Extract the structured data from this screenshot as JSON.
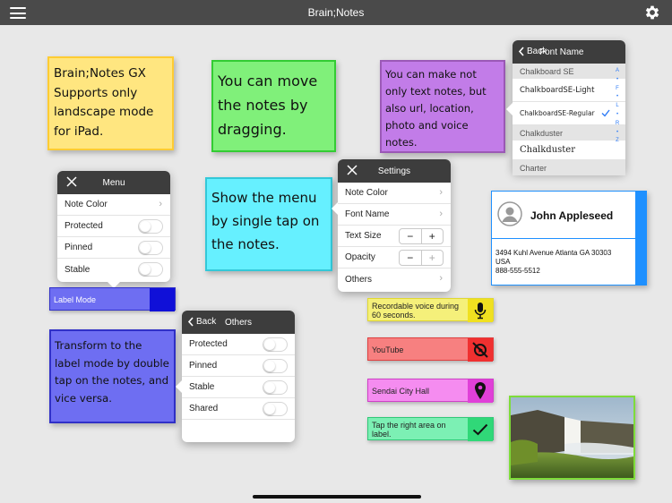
{
  "app": {
    "title": "Brain;Notes",
    "menu_icon": "hamburger-menu-icon",
    "settings_icon": "gear-icon"
  },
  "notes": {
    "yellow": {
      "text": "Brain;Notes GX Supports only landscape mode for iPad.",
      "color": "#ffe680",
      "border": "#ffcc33"
    },
    "green": {
      "text": "You can move the notes by dragging.",
      "color": "#80f07a",
      "border": "#33cc33"
    },
    "purple": {
      "text": "You can make not only text notes, but also url, location, photo and voice notes.",
      "color": "#c27ce8",
      "border": "#9b59b6"
    },
    "cyan": {
      "text": "Show the menu by single tap on the notes.",
      "color": "#66f0ff",
      "border": "#33c8d8"
    },
    "blue": {
      "text": "Transform to the label mode by double tap on the notes, and vice versa.",
      "color": "#6e6ef2",
      "border": "#3030c8"
    }
  },
  "menu_popup": {
    "title": "Menu",
    "close_icon": "close-icon",
    "items": [
      "Note Color",
      "Protected",
      "Pinned",
      "Stable"
    ]
  },
  "settings_popup": {
    "title": "Settings",
    "close_icon": "close-icon",
    "items": [
      "Note Color",
      "Font Name",
      "Text Size",
      "Opacity",
      "Others"
    ],
    "minus": "−",
    "plus": "+"
  },
  "others_popup": {
    "title": "Others",
    "back": "Back",
    "items": [
      "Protected",
      "Pinned",
      "Stable",
      "Shared"
    ]
  },
  "font_popup": {
    "title": "Font Name",
    "back": "Back",
    "sections": [
      "Chalkboard SE",
      "Chalkduster",
      "Charter"
    ],
    "chalkboard_fonts": [
      "ChalkboardSE-Light",
      "ChalkboardSE-Regular"
    ],
    "chalkduster_fonts": [
      "Chalkduster"
    ],
    "index_letters": [
      "A",
      "•",
      "F",
      "•",
      "L",
      "•",
      "R",
      "•",
      "Z"
    ],
    "check_icon": "checkmark-icon"
  },
  "label_mode": {
    "text": "Label Mode",
    "color": "#6e6ef2",
    "tab_color": "#1010d8"
  },
  "contact": {
    "name": "John Appleseed",
    "address": "3494 Kuhl Avenue Atlanta GA 30303",
    "country": "USA",
    "phone": "888-555-5512",
    "avatar_icon": "person-avatar-icon"
  },
  "labels": [
    {
      "text": "Recordable voice during 60 seconds.",
      "color": "#f5f07a",
      "tab": "#f0e020",
      "icon": "microphone-icon"
    },
    {
      "text": "YouTube",
      "color": "#f78080",
      "tab": "#f03030",
      "icon": "youtube-crossed-icon"
    },
    {
      "text": "Sendai City Hall",
      "color": "#f58cf0",
      "tab": "#e040d8",
      "icon": "map-pin-icon"
    },
    {
      "text": "Tap the right area on label.",
      "color": "#7cf0b4",
      "tab": "#30d878",
      "icon": "checkmark-icon"
    }
  ],
  "photo": {
    "icon": "waterfall-photo-icon",
    "border": "#7edc3a"
  }
}
